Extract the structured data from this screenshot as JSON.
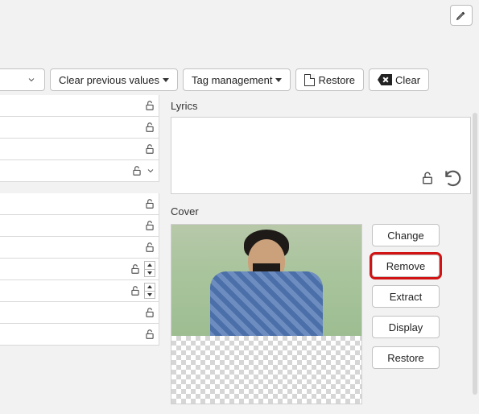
{
  "toolbar": {
    "clear_previous_label": "Clear previous values",
    "tag_management_label": "Tag management",
    "restore_label": "Restore",
    "clear_label": "Clear"
  },
  "sections": {
    "lyrics_label": "Lyrics",
    "cover_label": "Cover"
  },
  "cover_buttons": {
    "change": "Change",
    "remove": "Remove",
    "extract": "Extract",
    "display": "Display",
    "restore": "Restore"
  }
}
